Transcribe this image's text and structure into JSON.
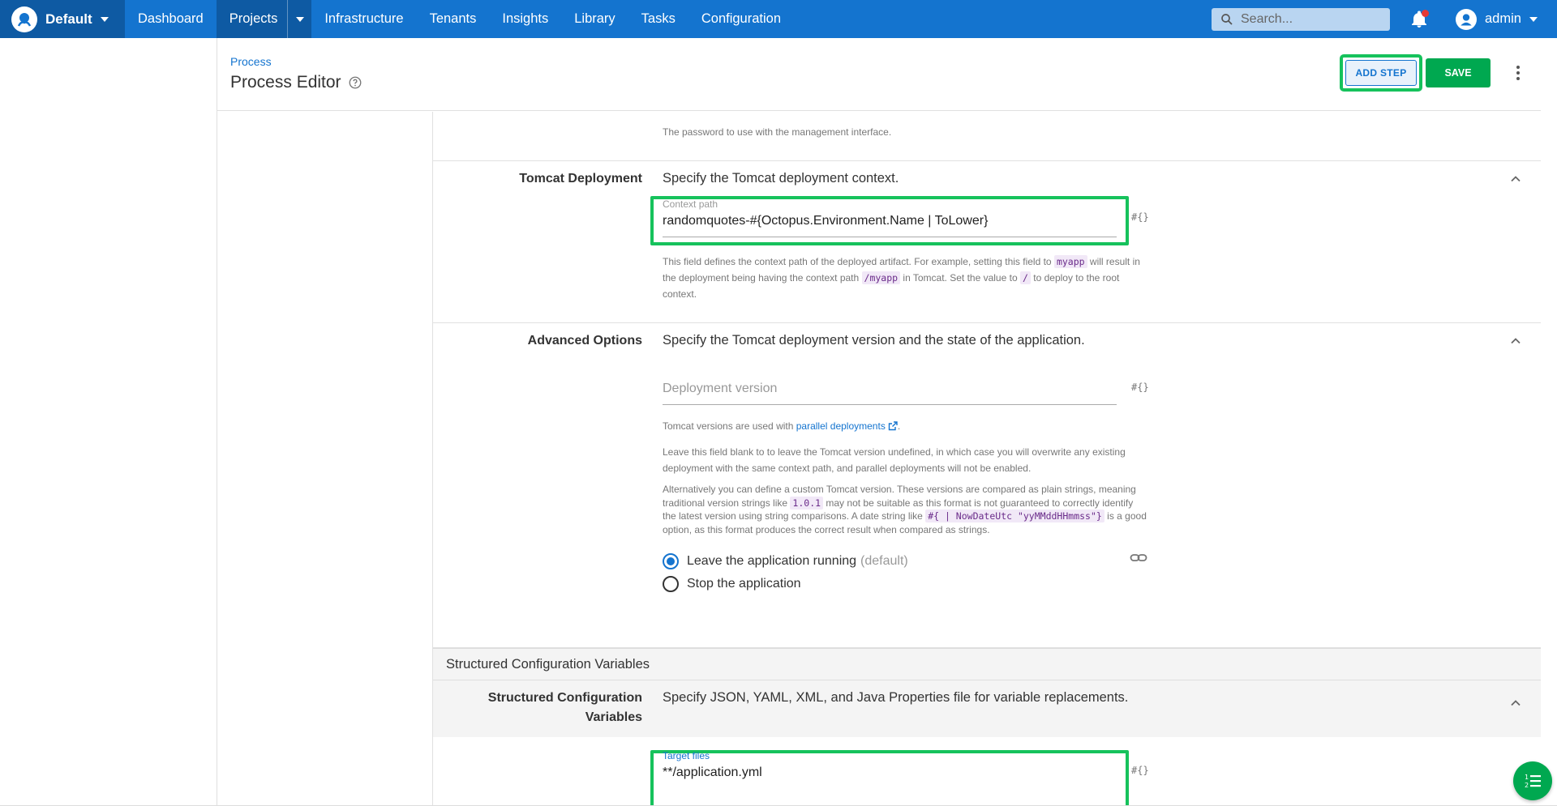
{
  "topbar": {
    "space": "Default",
    "nav": [
      "Dashboard",
      "Projects",
      "Infrastructure",
      "Tenants",
      "Insights",
      "Library",
      "Tasks",
      "Configuration"
    ],
    "search_placeholder": "Search...",
    "user": "admin"
  },
  "header": {
    "breadcrumb": "Process",
    "title": "Process Editor",
    "add_step_label": "ADD STEP",
    "save_label": "SAVE"
  },
  "password_section": {
    "help": "The password to use with the management interface."
  },
  "tomcat_deployment": {
    "label": "Tomcat Deployment",
    "description": "Specify the Tomcat deployment context.",
    "field_label": "Context path",
    "field_value": "randomquotes-#{Octopus.Environment.Name | ToLower}",
    "help_1": "This field defines the context path of the deployed artifact. For example, setting this field to",
    "code_1": "myapp",
    "help_2": "will result in the deployment being having the context path",
    "code_2": "/myapp",
    "help_3": "in Tomcat. Set the value to",
    "code_3": "/",
    "help_4": "to deploy to the root context."
  },
  "advanced_options": {
    "label": "Advanced Options",
    "description": "Specify the Tomcat deployment version and the state of the application.",
    "field_placeholder": "Deployment version",
    "versions_prefix": "Tomcat versions are used with",
    "versions_link": "parallel deployments",
    "versions_suffix": ".",
    "para_blank": "Leave this field blank to to leave the Tomcat version undefined, in which case you will overwrite any existing deployment with the same context path, and parallel deployments will not be enabled.",
    "alt_1": "Alternatively you can define a custom Tomcat version. These versions are compared as plain strings, meaning traditional version strings like",
    "alt_code_1": "1.0.1",
    "alt_2": "may not be suitable as this format is not guaranteed to correctly identify the latest version using string comparisons. A date string like",
    "alt_code_2": "#{ | NowDateUtc \"yyMMddHHmmss\"}",
    "alt_3": "is a good option, as this format produces the correct result when compared as strings.",
    "radio_running": "Leave the application running",
    "radio_running_suffix": "(default)",
    "radio_stop": "Stop the application"
  },
  "structured_config": {
    "group_title": "Structured Configuration Variables",
    "label": "Structured Configuration Variables",
    "description": "Specify JSON, YAML, XML, and Java Properties file for variable replacements.",
    "field_label": "Target files",
    "field_value": "**/application.yml"
  },
  "icons": {
    "hash": "#{}"
  }
}
